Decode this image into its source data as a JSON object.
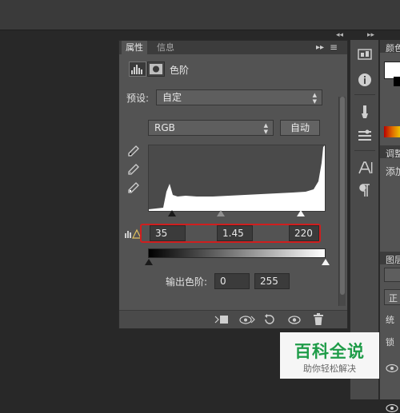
{
  "properties_panel": {
    "tabs": [
      {
        "label": "属性",
        "active": true
      },
      {
        "label": "信息",
        "active": false
      }
    ],
    "menu_glyphs": {
      "collapse": "▸▸",
      "menu": "≡"
    },
    "adjustment_title": "色阶",
    "preset": {
      "label": "预设:",
      "value": "自定"
    },
    "channel": {
      "value": "RGB"
    },
    "auto_button": "自动",
    "input_levels": {
      "black": "35",
      "gamma": "1.45",
      "white": "220"
    },
    "output_levels": {
      "label": "输出色阶:",
      "black": "0",
      "white": "255"
    }
  },
  "right_panel": {
    "labels": [
      "颜色",
      "调整",
      "添加",
      "图层",
      "正",
      "锁",
      "统"
    ]
  },
  "watermark": {
    "title": "百科全说",
    "subtitle": "助你轻松解决"
  },
  "colors": {
    "background": "#282828",
    "panel": "#535353",
    "highlight_box": "#d01e1e",
    "watermark_green": "#1e9c48"
  },
  "icons": [
    "levels-icon",
    "mask-icon",
    "eyedropper-icon",
    "eye-icon",
    "trash-icon",
    "reset-icon",
    "clip-icon",
    "info-icon",
    "brush-icon",
    "type-icon",
    "paragraph-icon"
  ]
}
